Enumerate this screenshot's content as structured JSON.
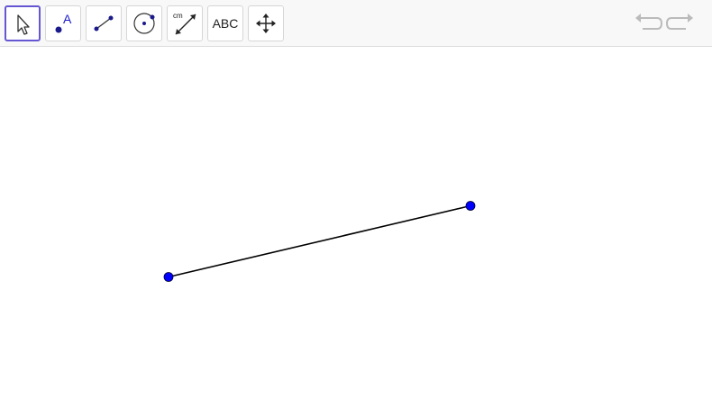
{
  "toolbar": {
    "tools": [
      {
        "name": "move",
        "icon": "cursor-arrow-icon",
        "active": true
      },
      {
        "name": "point",
        "icon": "point-a-icon",
        "label": "A"
      },
      {
        "name": "segment",
        "icon": "segment-icon"
      },
      {
        "name": "circle",
        "icon": "circle-center-point-icon"
      },
      {
        "name": "distance",
        "icon": "distance-measure-icon",
        "label": "cm"
      },
      {
        "name": "text",
        "icon": "text-icon",
        "label": "ABC"
      },
      {
        "name": "move-graphics",
        "icon": "move-graphics-icon"
      }
    ],
    "undo_icon": "undo-icon",
    "redo_icon": "redo-icon"
  },
  "colors": {
    "point_fill": "#0000ff",
    "segment_stroke": "#000000",
    "active_tool_border": "#6557d2",
    "toolbar_bg": "#f8f8f8",
    "disabled_icon": "#bbbbbb"
  }
}
